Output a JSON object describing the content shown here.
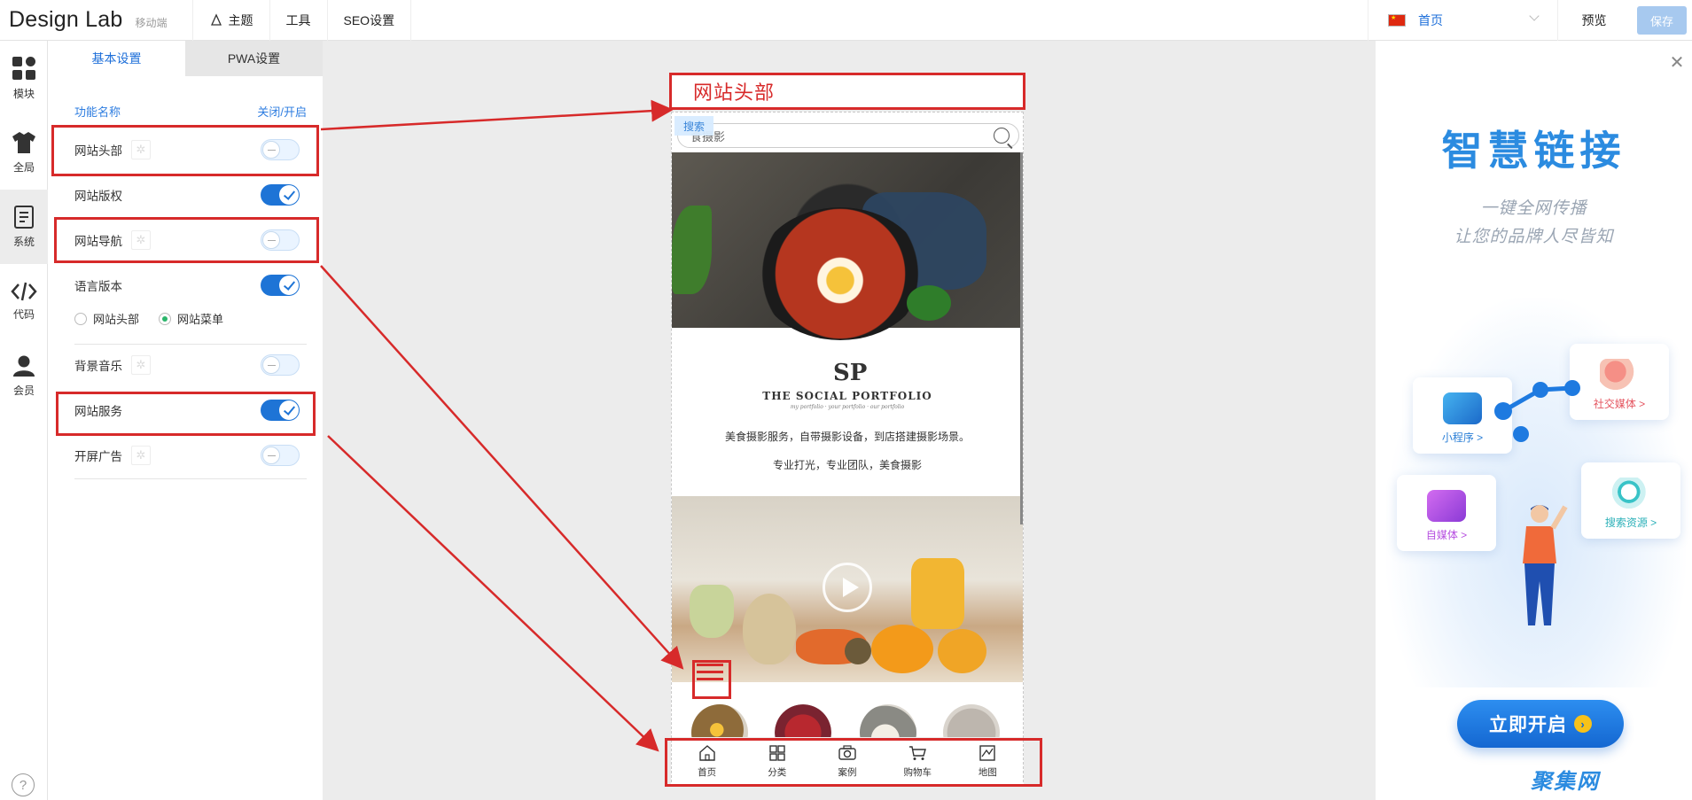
{
  "header": {
    "logo": "Design Lab",
    "mobile_label": "移动端",
    "menu": [
      {
        "label": "主题"
      },
      {
        "label": "工具"
      },
      {
        "label": "SEO设置"
      }
    ],
    "page_select": "首页",
    "preview": "预览",
    "save": "保存"
  },
  "rail": {
    "items": [
      {
        "label": "模块",
        "icon": "grid-icon"
      },
      {
        "label": "全局",
        "icon": "shirt-icon"
      },
      {
        "label": "系统",
        "icon": "document-icon",
        "active": true
      },
      {
        "label": "代码",
        "icon": "code-icon"
      },
      {
        "label": "会员",
        "icon": "user-icon"
      }
    ],
    "help": "?"
  },
  "panel": {
    "tabs": [
      {
        "label": "基本设置",
        "active": true
      },
      {
        "label": "PWA设置"
      }
    ],
    "col_name": "功能名称",
    "col_toggle": "关闭/开启",
    "rows": [
      {
        "label": "网站头部",
        "on": false,
        "gear": true
      },
      {
        "label": "网站版权",
        "on": true,
        "gear": false
      },
      {
        "label": "网站导航",
        "on": false,
        "gear": true
      },
      {
        "label": "语言版本",
        "on": true,
        "gear": false
      },
      {
        "label": "背景音乐",
        "on": false,
        "gear": true
      },
      {
        "label": "网站服务",
        "on": true,
        "gear": false
      },
      {
        "label": "开屏广告",
        "on": false,
        "gear": true
      }
    ],
    "radios": [
      {
        "label": "网站头部",
        "selected": false
      },
      {
        "label": "网站菜单",
        "selected": true
      }
    ]
  },
  "annotation": {
    "title": "网站头部",
    "color": "#d72a2a"
  },
  "preview": {
    "search_tag": "搜索",
    "search_text": "食摄影",
    "brand_mark": "SP",
    "brand_name": "THE SOCIAL PORTFOLIO",
    "brand_sub": "my portfolio · your portfolio · our portfolio",
    "desc1": "美食摄影服务，自带摄影设备，到店搭建摄影场景。",
    "desc2": "专业打光，专业团队，美食摄影",
    "nav": [
      {
        "label": "首页",
        "icon": "home-icon"
      },
      {
        "label": "分类",
        "icon": "category-icon"
      },
      {
        "label": "案例",
        "icon": "camera-icon"
      },
      {
        "label": "购物车",
        "icon": "cart-icon"
      },
      {
        "label": "地图",
        "icon": "map-icon"
      }
    ]
  },
  "promo": {
    "title": "智慧链接",
    "sub1": "一键全网传播",
    "sub2": "让您的品牌人尽皆知",
    "cards": [
      {
        "label": "小程序 >"
      },
      {
        "label": "社交媒体 >"
      },
      {
        "label": "自媒体 >"
      },
      {
        "label": "搜索资源 >"
      }
    ],
    "cta": "立即开启",
    "watermark": "聚集网"
  }
}
